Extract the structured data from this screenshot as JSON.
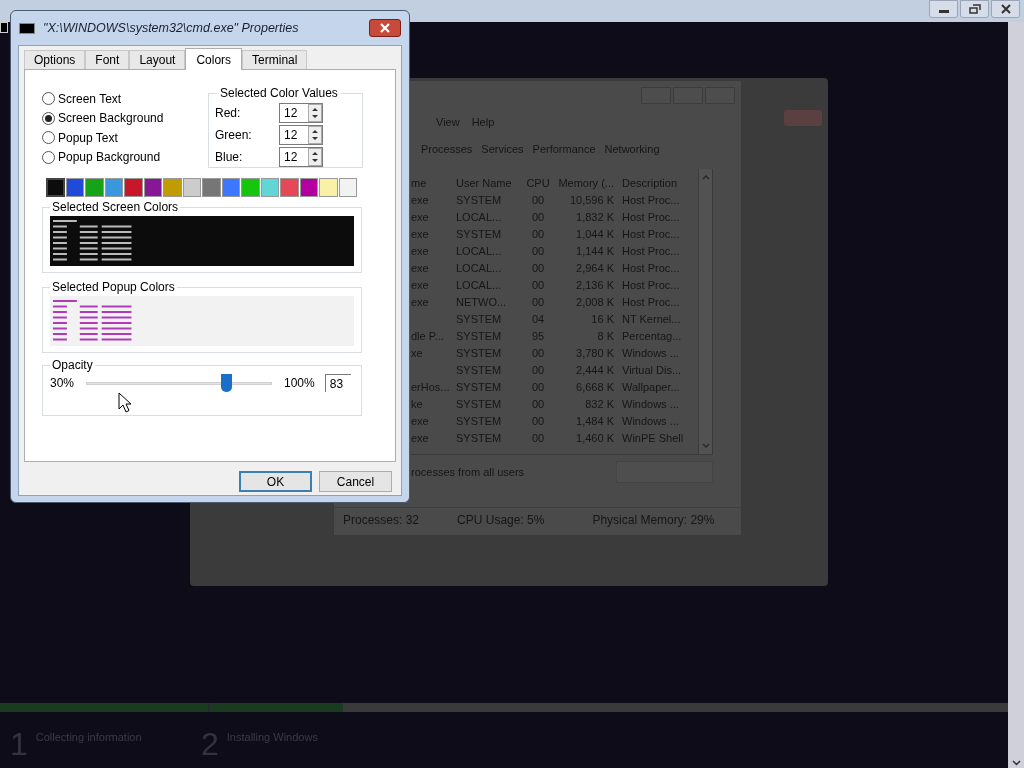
{
  "dialog": {
    "title": "\"X:\\WINDOWS\\system32\\cmd.exe\" Properties",
    "tabs": [
      {
        "label": "Options",
        "selected": false
      },
      {
        "label": "Font",
        "selected": false
      },
      {
        "label": "Layout",
        "selected": false
      },
      {
        "label": "Colors",
        "selected": true
      },
      {
        "label": "Terminal",
        "selected": false
      }
    ],
    "color_targets": [
      {
        "label": "Screen Text",
        "selected": false
      },
      {
        "label": "Screen Background",
        "selected": true
      },
      {
        "label": "Popup Text",
        "selected": false
      },
      {
        "label": "Popup Background",
        "selected": false
      }
    ],
    "color_values": {
      "title": "Selected Color Values",
      "fields": [
        {
          "label": "Red:",
          "value": "12"
        },
        {
          "label": "Green:",
          "value": "12"
        },
        {
          "label": "Blue:",
          "value": "12"
        }
      ]
    },
    "swatches": [
      {
        "color": "#0c0c0c",
        "selected": true
      },
      {
        "color": "#1f4bd8",
        "selected": false
      },
      {
        "color": "#17a317",
        "selected": false
      },
      {
        "color": "#3a96dd",
        "selected": false
      },
      {
        "color": "#c8172a",
        "selected": false
      },
      {
        "color": "#881798",
        "selected": false
      },
      {
        "color": "#c19c00",
        "selected": false
      },
      {
        "color": "#cccccc",
        "selected": false
      },
      {
        "color": "#767676",
        "selected": false
      },
      {
        "color": "#3b78ff",
        "selected": false
      },
      {
        "color": "#16c60c",
        "selected": false
      },
      {
        "color": "#61d6d6",
        "selected": false
      },
      {
        "color": "#e74856",
        "selected": false
      },
      {
        "color": "#b4009e",
        "selected": false
      },
      {
        "color": "#f9f1a5",
        "selected": false
      },
      {
        "color": "#f2f2f2",
        "selected": false
      }
    ],
    "screen_colors": {
      "title": "Selected Screen Colors"
    },
    "popup_colors": {
      "title": "Selected Popup Colors"
    },
    "opacity": {
      "title": "Opacity",
      "min_label": "30%",
      "max_label": "100%",
      "level": 0.76,
      "value": "83"
    },
    "buttons": [
      {
        "label": "OK",
        "default": true
      },
      {
        "label": "Cancel",
        "default": false
      }
    ]
  },
  "task_manager": {
    "menu": [
      "View",
      "Help"
    ],
    "tabs": [
      "Processes",
      "Services",
      "Performance",
      "Networking"
    ],
    "columns": [
      "me",
      "User Name",
      "CPU",
      "Memory (...",
      "Description"
    ],
    "rows": [
      [
        "exe",
        "SYSTEM",
        "00",
        "10,596 K",
        "Host Proc..."
      ],
      [
        "exe",
        "LOCAL...",
        "00",
        "1,832 K",
        "Host Proc..."
      ],
      [
        "exe",
        "SYSTEM",
        "00",
        "1,044 K",
        "Host Proc..."
      ],
      [
        "exe",
        "LOCAL...",
        "00",
        "1,144 K",
        "Host Proc..."
      ],
      [
        "exe",
        "LOCAL...",
        "00",
        "2,964 K",
        "Host Proc..."
      ],
      [
        "exe",
        "LOCAL...",
        "00",
        "2,136 K",
        "Host Proc..."
      ],
      [
        "exe",
        "NETWO...",
        "00",
        "2,008 K",
        "Host Proc..."
      ],
      [
        "",
        "SYSTEM",
        "04",
        "16 K",
        "NT Kernel..."
      ],
      [
        "dle P...",
        "SYSTEM",
        "95",
        "8 K",
        "Percentag..."
      ],
      [
        "xe",
        "SYSTEM",
        "00",
        "3,780 K",
        "Windows ..."
      ],
      [
        "",
        "SYSTEM",
        "00",
        "2,444 K",
        "Virtual Dis..."
      ],
      [
        "erHos...",
        "SYSTEM",
        "00",
        "6,668 K",
        "Wallpaper..."
      ],
      [
        "ke",
        "SYSTEM",
        "00",
        "832 K",
        "Windows ..."
      ],
      [
        "exe",
        "SYSTEM",
        "00",
        "1,484 K",
        "Windows ..."
      ],
      [
        "exe",
        "SYSTEM",
        "00",
        "1,460 K",
        "WinPE Shell"
      ]
    ],
    "show_all": "rocesses from all users",
    "status": [
      "Processes: 32",
      "CPU Usage: 5%",
      "Physical Memory: 29%"
    ]
  },
  "setup": {
    "progress": {
      "level": 0.34
    },
    "steps": [
      {
        "number": "1",
        "label": "Collecting information"
      },
      {
        "number": "2",
        "label": "Installing Windows"
      }
    ]
  }
}
